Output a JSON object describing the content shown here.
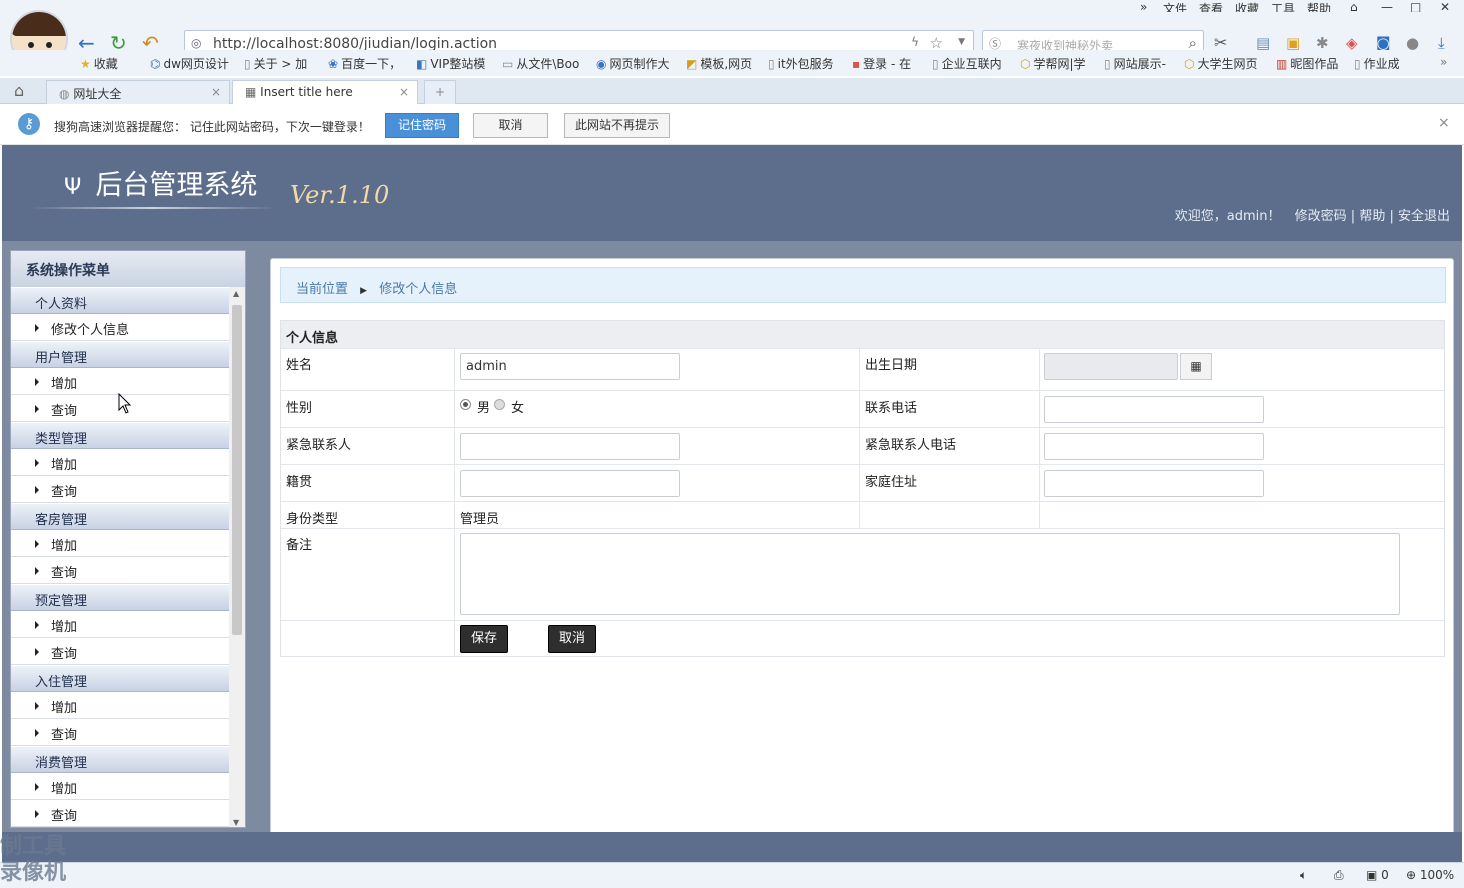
{
  "browser": {
    "menu": [
      "文件",
      "查看",
      "收藏",
      "工具",
      "帮助"
    ],
    "url": "http://localhost:8080/jiudian/login.action",
    "search_placeholder": "寒夜收到神秘外卖",
    "bookmarks": [
      "收藏",
      "dw网页设计",
      "关于 > 加",
      "百度一下，",
      "VIP整站模",
      "从文件\\Boo",
      "网页制作大",
      "模板,网页",
      "it外包服务",
      "登录 - 在",
      "企业互联内",
      "学帮网|学",
      "网站展示-",
      "大学生网页",
      "昵图作品",
      "作业成"
    ],
    "tabs": [
      {
        "title": "网址大全"
      },
      {
        "title": "Insert title here"
      }
    ],
    "notice": {
      "message": "搜狗高速浏览器提醒您： 记住此网站密码，下次一键登录！",
      "remember": "记住密码",
      "cancel": "取消",
      "never": "此网站不再提示"
    },
    "status": {
      "zoom": "100%",
      "count": "0"
    }
  },
  "header": {
    "logo": "后台管理系统",
    "version": "Ver.1.10",
    "welcome": "欢迎您，admin！",
    "change_password": "修改密码",
    "help": "帮助",
    "logout": "安全退出"
  },
  "sidebar": {
    "title": "系统操作菜单",
    "groups": [
      {
        "label": "个人资料",
        "items": [
          "修改个人信息"
        ]
      },
      {
        "label": "用户管理",
        "items": [
          "增加",
          "查询"
        ]
      },
      {
        "label": "类型管理",
        "items": [
          "增加",
          "查询"
        ]
      },
      {
        "label": "客房管理",
        "items": [
          "增加",
          "查询"
        ]
      },
      {
        "label": "预定管理",
        "items": [
          "增加",
          "查询"
        ]
      },
      {
        "label": "入住管理",
        "items": [
          "增加",
          "查询"
        ]
      },
      {
        "label": "消费管理",
        "items": [
          "增加",
          "查询"
        ]
      }
    ]
  },
  "breadcrumb": {
    "root": "当前位置",
    "current": "修改个人信息"
  },
  "form": {
    "section_title": "个人信息",
    "name_label": "姓名",
    "name_value": "admin",
    "birth_label": "出生日期",
    "birth_value": "",
    "gender_label": "性别",
    "gender_male": "男",
    "gender_female": "女",
    "phone_label": "联系电话",
    "emergency_label": "紧急联系人",
    "emergency_phone_label": "紧急联系人电话",
    "native_label": "籍贯",
    "address_label": "家庭住址",
    "role_label": "身份类型",
    "role_value": "管理员",
    "remark_label": "备注",
    "save": "保存",
    "cancel": "取消"
  },
  "watermark": [
    "制工具",
    "录像机"
  ]
}
